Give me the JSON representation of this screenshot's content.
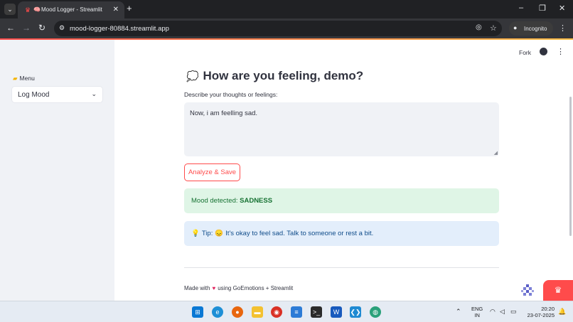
{
  "browser": {
    "tab_title": "Mood Logger - Streamlit",
    "tab_close": "✕",
    "new_tab": "+",
    "url": "mood-logger-80884.streamlit.app",
    "incognito_label": "Incognito",
    "window_controls": {
      "minimize": "–",
      "restore": "❐",
      "close": "✕"
    }
  },
  "header": {
    "fork_label": "Fork"
  },
  "sidebar": {
    "menu_label": "Menu",
    "select_value": "Log Mood"
  },
  "main": {
    "heading": "How are you feeling, demo?",
    "textarea_label": "Describe your thoughts or feelings:",
    "textarea_value": "Now, i am feelling sad.",
    "button_label": "Analyze & Save",
    "success_prefix": "Mood detected:",
    "success_mood": "SADNESS",
    "tip_prefix": "Tip:",
    "tip_text": "It's okay to feel sad. Talk to someone or rest a bit.",
    "footer_prefix": "Made with",
    "footer_suffix": "using GoEmotions + Streamlit"
  },
  "taskbar": {
    "lang_line1": "ENG",
    "lang_line2": "IN",
    "time": "20:20",
    "date": "23-07-2025"
  },
  "colors": {
    "accent": "#ff4b4b",
    "success_bg": "#dff5e6",
    "success_text": "#177233",
    "info_bg": "#e3eefb",
    "info_text": "#0f4c8a",
    "sidebar_bg": "#f0f2f6"
  },
  "icons": [
    "chevron-down-icon",
    "streamlit-crown-icon",
    "brain-icon",
    "back-arrow-icon",
    "forward-arrow-icon",
    "reload-icon",
    "site-info-icon",
    "eye-off-icon",
    "star-icon",
    "incognito-icon",
    "kebab-icon",
    "folder-icon",
    "thought-bubble-icon",
    "github-icon",
    "lightbulb-icon",
    "sad-face-icon",
    "heart-icon",
    "windows-start-icon"
  ]
}
